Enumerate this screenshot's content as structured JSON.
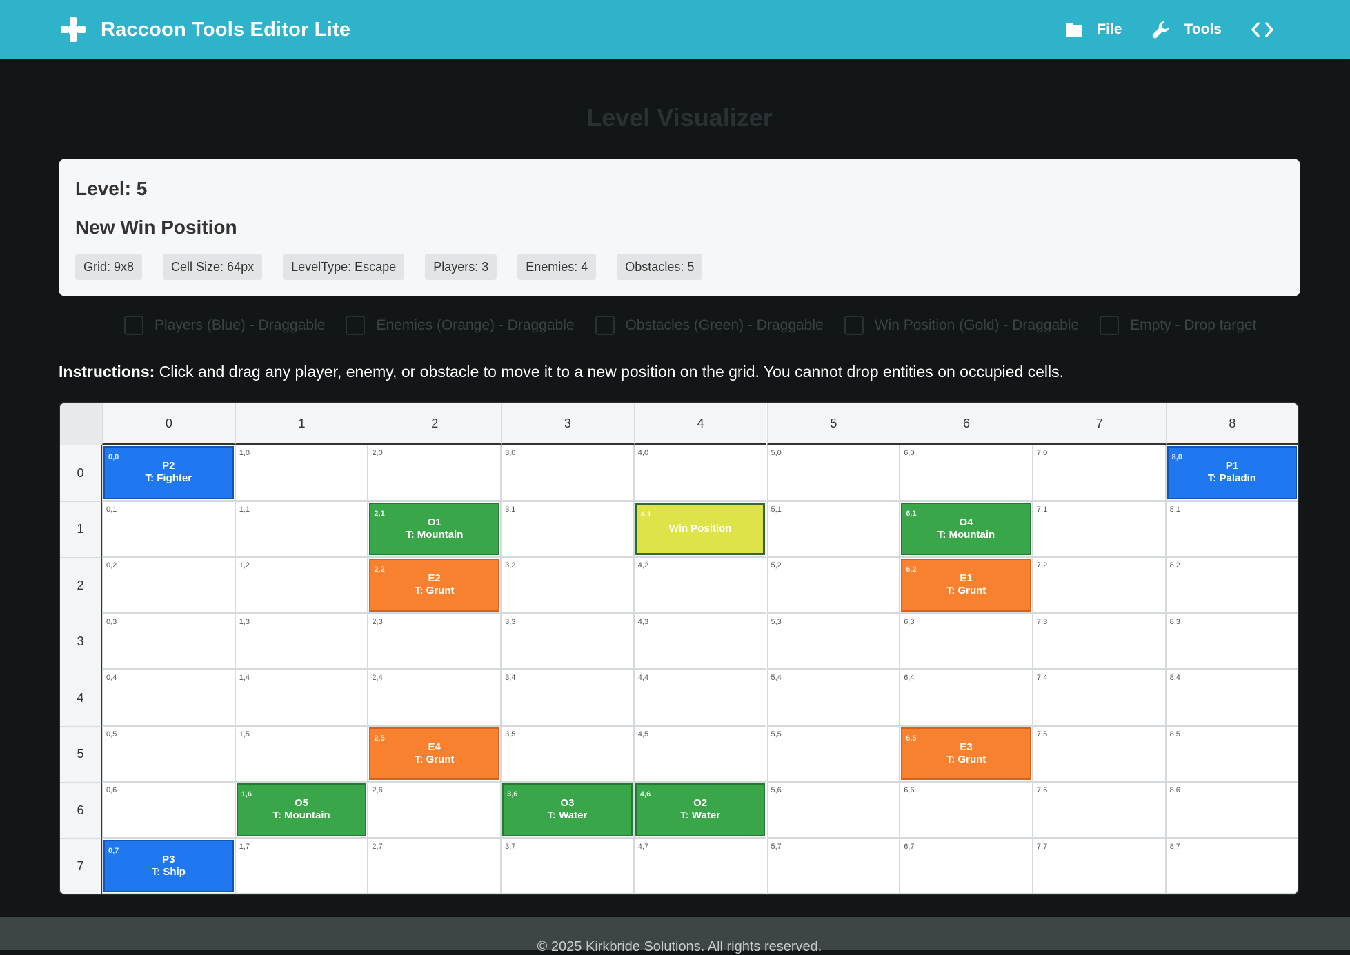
{
  "app": {
    "title": "Raccoon Tools Editor Lite",
    "brand_icon": "gamepad-icon",
    "nav": [
      {
        "label": "File",
        "icon": "folder-icon"
      },
      {
        "label": "Tools",
        "icon": "wrench-icon"
      },
      {
        "label": "",
        "icon": "code-icon"
      }
    ]
  },
  "page": {
    "title": "Level Visualizer"
  },
  "level": {
    "label": "Level: 5",
    "name": "New Win Position",
    "stats": [
      "Grid: 9x8",
      "Cell Size: 64px",
      "LevelType: Escape",
      "Players: 3",
      "Enemies: 4",
      "Obstacles: 5"
    ]
  },
  "legend": [
    "Players (Blue) - Draggable",
    "Enemies (Orange) - Draggable",
    "Obstacles (Green) - Draggable",
    "Win Position (Gold) - Draggable",
    "Empty - Drop target"
  ],
  "instructions": {
    "label": "Instructions:",
    "text": " Click and drag any player, enemy, or obstacle to move it to a new position on the grid. You cannot drop entities on occupied cells."
  },
  "grid": {
    "cols": 9,
    "rows": 8,
    "col_headers": [
      "0",
      "1",
      "2",
      "3",
      "4",
      "5",
      "6",
      "7",
      "8"
    ],
    "row_headers": [
      "0",
      "1",
      "2",
      "3",
      "4",
      "5",
      "6",
      "7"
    ],
    "entities": [
      {
        "x": 0,
        "y": 0,
        "kind": "player",
        "name": "P2",
        "type": "T: Fighter"
      },
      {
        "x": 8,
        "y": 0,
        "kind": "player",
        "name": "P1",
        "type": "T: Paladin"
      },
      {
        "x": 0,
        "y": 7,
        "kind": "player",
        "name": "P3",
        "type": "T: Ship"
      },
      {
        "x": 2,
        "y": 1,
        "kind": "obstacle",
        "name": "O1",
        "type": "T: Mountain"
      },
      {
        "x": 6,
        "y": 1,
        "kind": "obstacle",
        "name": "O4",
        "type": "T: Mountain"
      },
      {
        "x": 1,
        "y": 6,
        "kind": "obstacle",
        "name": "O5",
        "type": "T: Mountain"
      },
      {
        "x": 3,
        "y": 6,
        "kind": "obstacle",
        "name": "O3",
        "type": "T: Water"
      },
      {
        "x": 4,
        "y": 6,
        "kind": "obstacle",
        "name": "O2",
        "type": "T: Water"
      },
      {
        "x": 2,
        "y": 2,
        "kind": "enemy",
        "name": "E2",
        "type": "T: Grunt"
      },
      {
        "x": 6,
        "y": 2,
        "kind": "enemy",
        "name": "E1",
        "type": "T: Grunt"
      },
      {
        "x": 2,
        "y": 5,
        "kind": "enemy",
        "name": "E4",
        "type": "T: Grunt"
      },
      {
        "x": 6,
        "y": 5,
        "kind": "enemy",
        "name": "E3",
        "type": "T: Grunt"
      },
      {
        "x": 4,
        "y": 1,
        "kind": "win",
        "name": "Win Position",
        "type": ""
      }
    ]
  },
  "footer": {
    "text": "© 2025 Kirkbride Solutions. All rights reserved."
  }
}
